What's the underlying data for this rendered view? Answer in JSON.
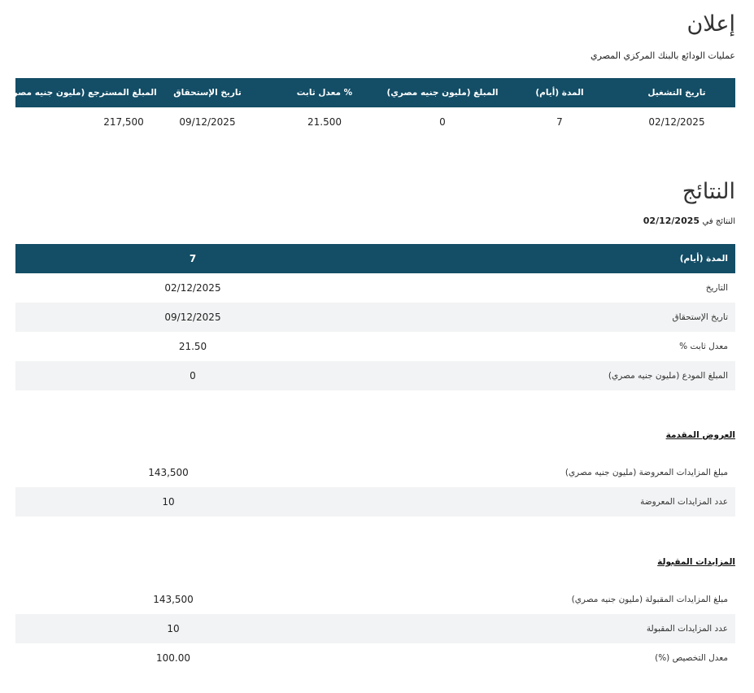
{
  "announcement": {
    "title": "إعلان",
    "subtitle": "عمليات الودائع بالبنك المركزي المصري",
    "columns": [
      "تاريخ التشغيل",
      "المدة (أيام)",
      "المبلغ (مليون جنيه مصري)",
      "معدل ثابت %",
      "تاريخ الإستحقاق",
      "المبلغ المسترجع (مليون جنيه مصري)"
    ],
    "values": [
      "02/12/2025",
      "7",
      "0",
      "21.500",
      "09/12/2025",
      "217,500"
    ]
  },
  "results": {
    "title": "النتائج",
    "subtitle_label": "النتائج في",
    "subtitle_date": "02/12/2025",
    "header_label": "المدة (أيام)",
    "header_value": "7",
    "rows": [
      {
        "label": "التاريخ",
        "value": "02/12/2025"
      },
      {
        "label": "تاريخ الإستحقاق",
        "value": "09/12/2025"
      },
      {
        "label": "معدل ثابت %",
        "value": "21.50"
      },
      {
        "label": "المبلغ المودع (مليون جنيه مصري)",
        "value": "0"
      }
    ]
  },
  "offers": {
    "title": "العروض المقدمة",
    "rows": [
      {
        "label": "مبلغ المزايدات المعروضة (مليون جنيه مصري)",
        "value": "143,500"
      },
      {
        "label": "عدد المزايدات المعروضة",
        "value": "10"
      }
    ]
  },
  "accepted": {
    "title": "المزايدات المقبولة",
    "rows": [
      {
        "label": "مبلغ المزايدات المقبولة (مليون جنيه مصري)",
        "value": "143,500"
      },
      {
        "label": "عدد المزايدات المقبولة",
        "value": "10"
      },
      {
        "label": "معدل التخصيص (%)",
        "value": "100.00"
      }
    ]
  },
  "colors": {
    "header_bg": "#134d66",
    "alt_row": "#f2f3f4"
  }
}
